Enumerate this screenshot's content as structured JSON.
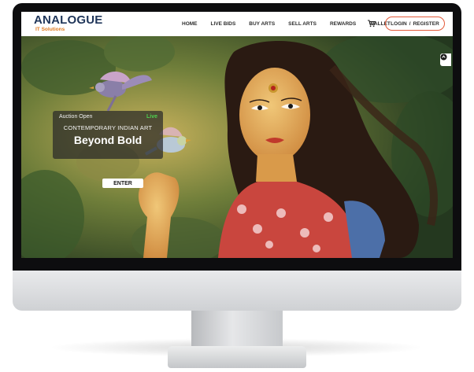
{
  "brand": {
    "logo_main": "ANALOGUE",
    "logo_sub": "IT Solutions",
    "accent_color": "#e07a1f",
    "logo_color": "#1f3559"
  },
  "nav": {
    "items": [
      {
        "label": "HOME"
      },
      {
        "label": "LIVE BIDS"
      },
      {
        "label": "BUY ARTS"
      },
      {
        "label": "SELL ARTS"
      },
      {
        "label": "REWARDS"
      },
      {
        "label": "WALLET"
      }
    ],
    "cart_icon": "cart-icon",
    "login_label": "LOGIN",
    "separator": "/",
    "register_label": "REGISTER",
    "login_border_color": "#e35a3a"
  },
  "auction": {
    "status": "Auction Open",
    "live_label": "Live",
    "live_color": "#4fd14f",
    "category": "CONTEMPORARY INDIAN ART",
    "title": "Beyond Bold",
    "enter_label": "ENTER"
  },
  "side_button_icon": "chat-icon"
}
